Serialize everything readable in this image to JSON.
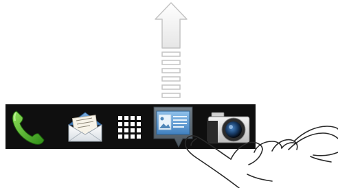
{
  "gesture": {
    "type": "swipe-up",
    "arrow_icon": "arrow-up-icon",
    "hand_icon": "pointing-hand-icon"
  },
  "dock": {
    "background": "#0f0f0f",
    "items": [
      {
        "id": "phone",
        "icon": "phone-icon",
        "state": "normal"
      },
      {
        "id": "mail",
        "icon": "mail-icon",
        "state": "normal"
      },
      {
        "id": "apps",
        "icon": "all-apps-grid-icon",
        "state": "normal"
      },
      {
        "id": "messages",
        "icon": "messages-icon",
        "state": "selected"
      },
      {
        "id": "camera",
        "icon": "camera-icon",
        "state": "normal"
      }
    ]
  },
  "colors": {
    "phone_green": "#4caf2a",
    "messages_blue": "#4f86b8",
    "selected_bg": "#5a6b78",
    "arrow_stroke": "#c8c8c8"
  }
}
